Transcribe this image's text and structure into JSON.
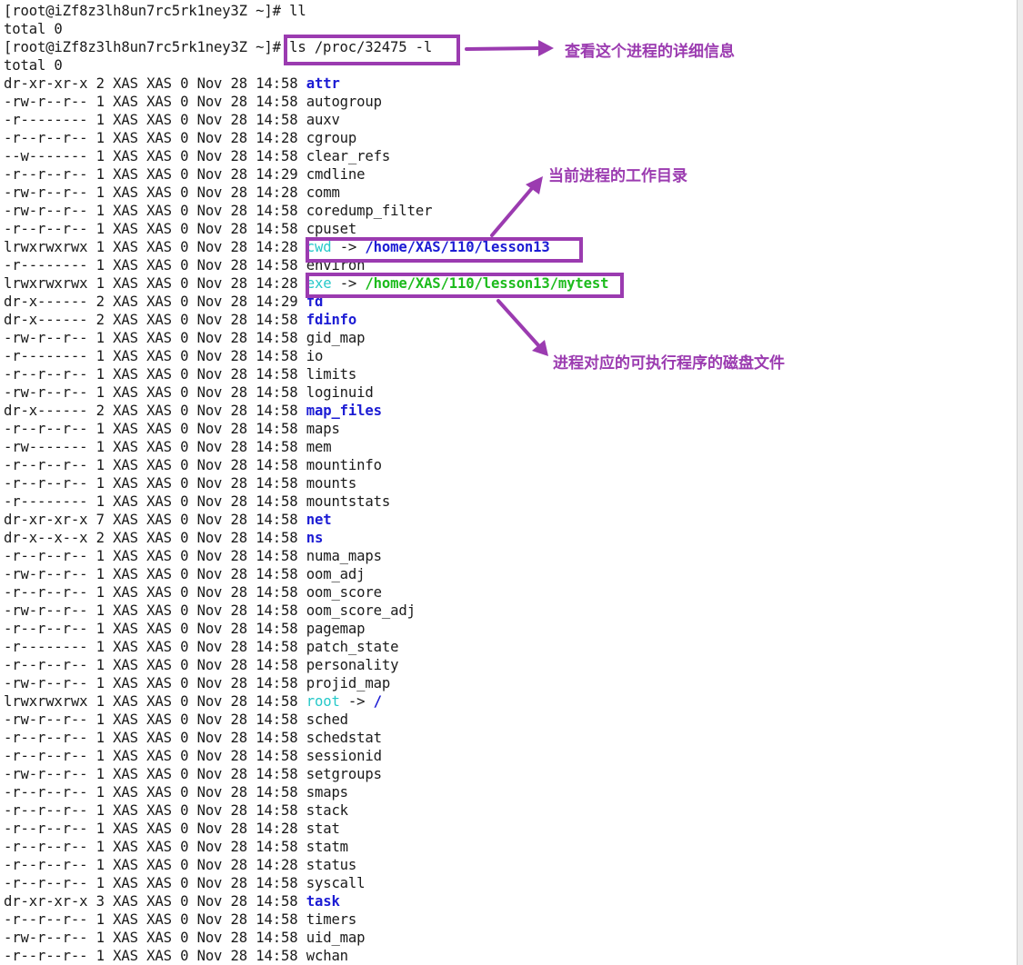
{
  "terminal": {
    "prompt": "[root@iZf8z3lh8un7rc5rk1ney3Z ~]# ",
    "cmd1": "ll",
    "total1": "total 0",
    "cmd2": "ls /proc/32475 -l",
    "total2": "total 0",
    "entries": [
      {
        "perm": "dr-xr-xr-x",
        "links": "2",
        "time": "14:58",
        "name": "attr",
        "kind": "dir"
      },
      {
        "perm": "-rw-r--r--",
        "links": "1",
        "time": "14:58",
        "name": "autogroup",
        "kind": "file"
      },
      {
        "perm": "-r--------",
        "links": "1",
        "time": "14:58",
        "name": "auxv",
        "kind": "file"
      },
      {
        "perm": "-r--r--r--",
        "links": "1",
        "time": "14:28",
        "name": "cgroup",
        "kind": "file"
      },
      {
        "perm": "--w-------",
        "links": "1",
        "time": "14:58",
        "name": "clear_refs",
        "kind": "file"
      },
      {
        "perm": "-r--r--r--",
        "links": "1",
        "time": "14:29",
        "name": "cmdline",
        "kind": "file"
      },
      {
        "perm": "-rw-r--r--",
        "links": "1",
        "time": "14:28",
        "name": "comm",
        "kind": "file"
      },
      {
        "perm": "-rw-r--r--",
        "links": "1",
        "time": "14:58",
        "name": "coredump_filter",
        "kind": "file"
      },
      {
        "perm": "-r--r--r--",
        "links": "1",
        "time": "14:58",
        "name": "cpuset",
        "kind": "file"
      },
      {
        "perm": "lrwxrwxrwx",
        "links": "1",
        "time": "14:28",
        "name": "cwd",
        "kind": "link",
        "target": "/home/XAS/110/lesson13",
        "target_kind": "dir"
      },
      {
        "perm": "-r--------",
        "links": "1",
        "time": "14:58",
        "name": "environ",
        "kind": "file"
      },
      {
        "perm": "lrwxrwxrwx",
        "links": "1",
        "time": "14:28",
        "name": "exe",
        "kind": "link",
        "target": "/home/XAS/110/lesson13/mytest",
        "target_kind": "exe"
      },
      {
        "perm": "dr-x------",
        "links": "2",
        "time": "14:29",
        "name": "fd",
        "kind": "dir"
      },
      {
        "perm": "dr-x------",
        "links": "2",
        "time": "14:58",
        "name": "fdinfo",
        "kind": "dir"
      },
      {
        "perm": "-rw-r--r--",
        "links": "1",
        "time": "14:58",
        "name": "gid_map",
        "kind": "file"
      },
      {
        "perm": "-r--------",
        "links": "1",
        "time": "14:58",
        "name": "io",
        "kind": "file"
      },
      {
        "perm": "-r--r--r--",
        "links": "1",
        "time": "14:58",
        "name": "limits",
        "kind": "file"
      },
      {
        "perm": "-rw-r--r--",
        "links": "1",
        "time": "14:58",
        "name": "loginuid",
        "kind": "file"
      },
      {
        "perm": "dr-x------",
        "links": "2",
        "time": "14:58",
        "name": "map_files",
        "kind": "dir"
      },
      {
        "perm": "-r--r--r--",
        "links": "1",
        "time": "14:58",
        "name": "maps",
        "kind": "file"
      },
      {
        "perm": "-rw-------",
        "links": "1",
        "time": "14:58",
        "name": "mem",
        "kind": "file"
      },
      {
        "perm": "-r--r--r--",
        "links": "1",
        "time": "14:58",
        "name": "mountinfo",
        "kind": "file"
      },
      {
        "perm": "-r--r--r--",
        "links": "1",
        "time": "14:58",
        "name": "mounts",
        "kind": "file"
      },
      {
        "perm": "-r--------",
        "links": "1",
        "time": "14:58",
        "name": "mountstats",
        "kind": "file"
      },
      {
        "perm": "dr-xr-xr-x",
        "links": "7",
        "time": "14:58",
        "name": "net",
        "kind": "dir"
      },
      {
        "perm": "dr-x--x--x",
        "links": "2",
        "time": "14:58",
        "name": "ns",
        "kind": "dir"
      },
      {
        "perm": "-r--r--r--",
        "links": "1",
        "time": "14:58",
        "name": "numa_maps",
        "kind": "file"
      },
      {
        "perm": "-rw-r--r--",
        "links": "1",
        "time": "14:58",
        "name": "oom_adj",
        "kind": "file"
      },
      {
        "perm": "-r--r--r--",
        "links": "1",
        "time": "14:58",
        "name": "oom_score",
        "kind": "file"
      },
      {
        "perm": "-rw-r--r--",
        "links": "1",
        "time": "14:58",
        "name": "oom_score_adj",
        "kind": "file"
      },
      {
        "perm": "-r--r--r--",
        "links": "1",
        "time": "14:58",
        "name": "pagemap",
        "kind": "file"
      },
      {
        "perm": "-r--------",
        "links": "1",
        "time": "14:58",
        "name": "patch_state",
        "kind": "file"
      },
      {
        "perm": "-r--r--r--",
        "links": "1",
        "time": "14:58",
        "name": "personality",
        "kind": "file"
      },
      {
        "perm": "-rw-r--r--",
        "links": "1",
        "time": "14:58",
        "name": "projid_map",
        "kind": "file"
      },
      {
        "perm": "lrwxrwxrwx",
        "links": "1",
        "time": "14:58",
        "name": "root",
        "kind": "link",
        "target": "/",
        "target_kind": "dir"
      },
      {
        "perm": "-rw-r--r--",
        "links": "1",
        "time": "14:58",
        "name": "sched",
        "kind": "file"
      },
      {
        "perm": "-r--r--r--",
        "links": "1",
        "time": "14:58",
        "name": "schedstat",
        "kind": "file"
      },
      {
        "perm": "-r--r--r--",
        "links": "1",
        "time": "14:58",
        "name": "sessionid",
        "kind": "file"
      },
      {
        "perm": "-rw-r--r--",
        "links": "1",
        "time": "14:58",
        "name": "setgroups",
        "kind": "file"
      },
      {
        "perm": "-r--r--r--",
        "links": "1",
        "time": "14:58",
        "name": "smaps",
        "kind": "file"
      },
      {
        "perm": "-r--r--r--",
        "links": "1",
        "time": "14:58",
        "name": "stack",
        "kind": "file"
      },
      {
        "perm": "-r--r--r--",
        "links": "1",
        "time": "14:28",
        "name": "stat",
        "kind": "file"
      },
      {
        "perm": "-r--r--r--",
        "links": "1",
        "time": "14:58",
        "name": "statm",
        "kind": "file"
      },
      {
        "perm": "-r--r--r--",
        "links": "1",
        "time": "14:28",
        "name": "status",
        "kind": "file"
      },
      {
        "perm": "-r--r--r--",
        "links": "1",
        "time": "14:58",
        "name": "syscall",
        "kind": "file"
      },
      {
        "perm": "dr-xr-xr-x",
        "links": "3",
        "time": "14:58",
        "name": "task",
        "kind": "dir"
      },
      {
        "perm": "-r--r--r--",
        "links": "1",
        "time": "14:58",
        "name": "timers",
        "kind": "file"
      },
      {
        "perm": "-rw-r--r--",
        "links": "1",
        "time": "14:58",
        "name": "uid_map",
        "kind": "file"
      },
      {
        "perm": "-r--r--r--",
        "links": "1",
        "time": "14:58",
        "name": "wchan",
        "kind": "file"
      }
    ],
    "owner": "XAS",
    "group": "XAS",
    "size": "0",
    "month": "Nov",
    "day": "28",
    "link_arrow": " -> "
  },
  "annotations": {
    "cmd_note": "查看这个进程的详细信息",
    "cwd_note": "当前进程的工作目录",
    "exe_note": "进程对应的可执行程序的磁盘文件"
  },
  "colors": {
    "accent": "#9b3bb0",
    "directory": "#1c1cd4",
    "symlink": "#26c9c9",
    "executable": "#1dbb1d"
  }
}
